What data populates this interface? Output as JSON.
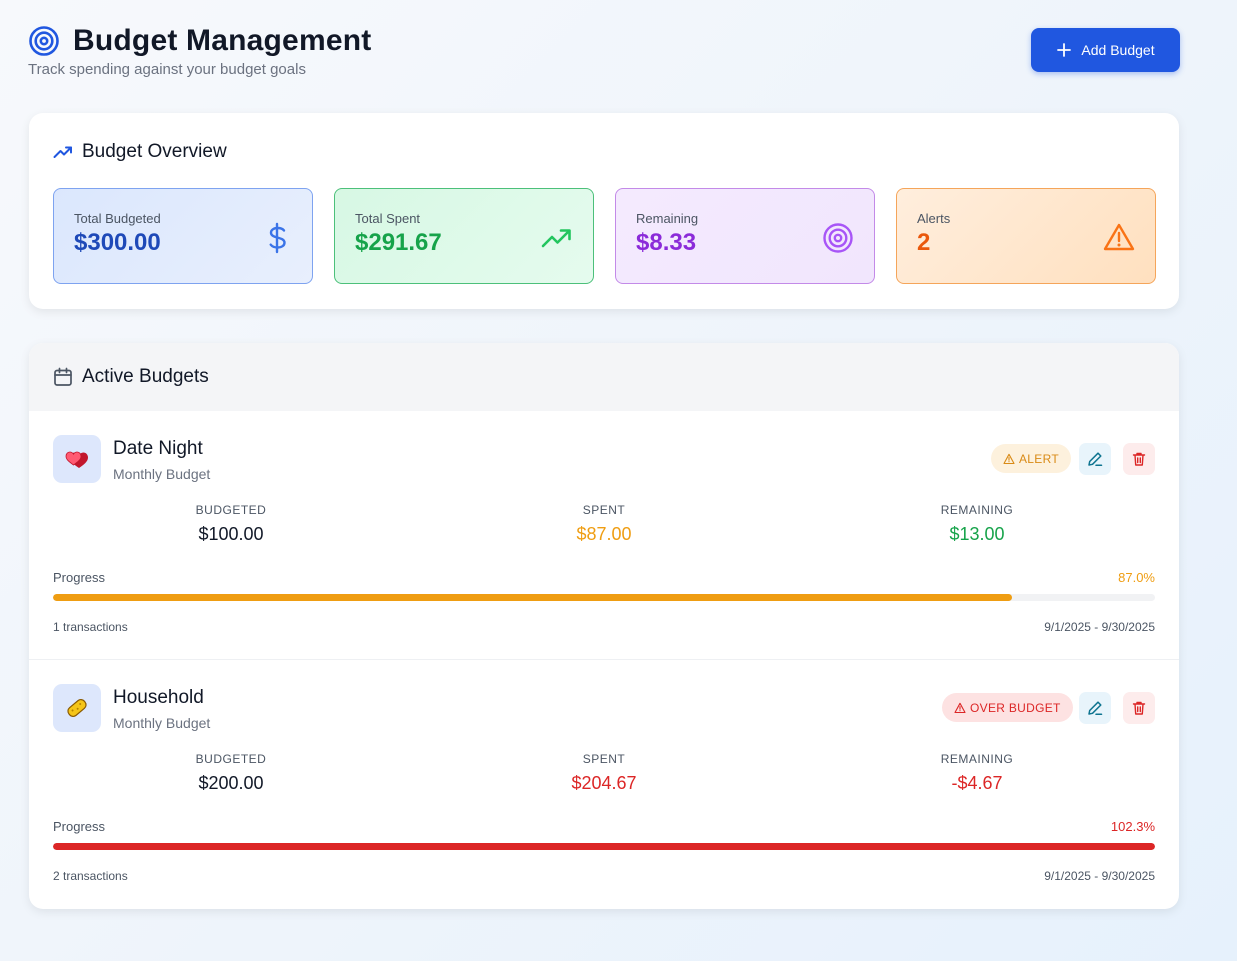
{
  "header": {
    "title": "Budget Management",
    "subtitle": "Track spending against your budget goals",
    "add_button_label": "Add Budget"
  },
  "overview": {
    "title": "Budget Overview",
    "stats": [
      {
        "label": "Total Budgeted",
        "value": "$300.00",
        "icon": "dollar-icon"
      },
      {
        "label": "Total Spent",
        "value": "$291.67",
        "icon": "trending-up-icon"
      },
      {
        "label": "Remaining",
        "value": "$8.33",
        "icon": "target-icon"
      },
      {
        "label": "Alerts",
        "value": "2",
        "icon": "warning-icon"
      }
    ]
  },
  "active_budgets": {
    "title": "Active Budgets",
    "metric_labels": {
      "budgeted": "BUDGETED",
      "spent": "SPENT",
      "remaining": "REMAINING"
    },
    "progress_label": "Progress",
    "items": [
      {
        "name": "Date Night",
        "type": "Monthly Budget",
        "icon": "hearts-icon",
        "badge": "ALERT",
        "budgeted": "$100.00",
        "spent": "$87.00",
        "remaining": "$13.00",
        "progress_pct": "87.0%",
        "progress_fraction": 0.87,
        "transactions": "1 transactions",
        "date_range": "9/1/2025 - 9/30/2025"
      },
      {
        "name": "Household",
        "type": "Monthly Budget",
        "icon": "sponge-icon",
        "badge": "OVER BUDGET",
        "budgeted": "$200.00",
        "spent": "$204.67",
        "remaining": "-$4.67",
        "progress_pct": "102.3%",
        "progress_fraction": 1.0,
        "transactions": "2 transactions",
        "date_range": "9/1/2025 - 9/30/2025"
      }
    ]
  },
  "colors": {
    "primary": "#2057e0",
    "amber": "#ef9d12",
    "red": "#dc2626",
    "green": "#16a34a",
    "purple": "#8b2bd9",
    "orange": "#ea580c"
  }
}
